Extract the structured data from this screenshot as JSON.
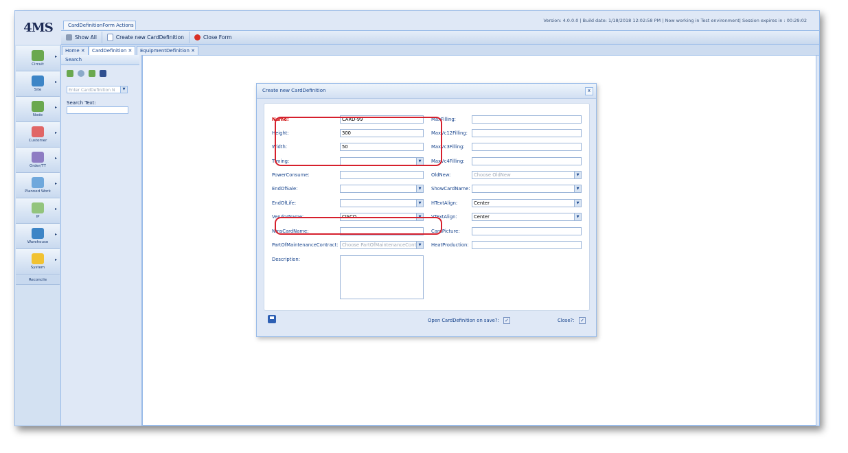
{
  "app": {
    "logo": "4MS",
    "version_info": "Version: 4.0.0.0 | Build date: 1/18/2018 12:02:58 PM | Now working in Test environment| Session expires in : 00:29:02"
  },
  "actions": {
    "title": "CardDefinitionForm Actions",
    "show_all": "Show All",
    "create_new": "Create new CardDefinition",
    "close_form": "Close Form"
  },
  "nav": {
    "items": [
      {
        "label": "Circuit",
        "icon": "circuit-icon",
        "color": "#6aa84f"
      },
      {
        "label": "Site",
        "icon": "site-icon",
        "color": "#3d85c6"
      },
      {
        "label": "Node",
        "icon": "node-icon",
        "color": "#6aa84f"
      },
      {
        "label": "Customer",
        "icon": "customer-icon",
        "color": "#e06666"
      },
      {
        "label": "Order/TT",
        "icon": "order-icon",
        "color": "#8e7cc3"
      },
      {
        "label": "Planned Work",
        "icon": "planned-work-icon",
        "color": "#6fa8dc"
      },
      {
        "label": "IP",
        "icon": "ip-icon",
        "color": "#93c47d"
      },
      {
        "label": "Warehouse",
        "icon": "warehouse-icon",
        "color": "#3d85c6"
      },
      {
        "label": "System",
        "icon": "system-icon",
        "color": "#f1c232"
      }
    ],
    "reconcile": "Reconcile"
  },
  "tabs": [
    {
      "label": "Home",
      "close": "✕"
    },
    {
      "label": "CardDefinition",
      "close": "✕"
    },
    {
      "label": "EquipmentDefinition",
      "close": "✕"
    }
  ],
  "search": {
    "title": "Search",
    "combo_placeholder": "Enter CardDefinition N",
    "search_text_label": "Search Text:"
  },
  "dialog": {
    "title": "Create new CardDefinition",
    "close": "x",
    "left_fields": {
      "name": {
        "label": "Name:",
        "value": "CARD-99"
      },
      "height": {
        "label": "Height:",
        "value": "300"
      },
      "width": {
        "label": "Width:",
        "value": "50"
      },
      "timing": {
        "label": "Timing:",
        "value": ""
      },
      "power_consume": {
        "label": "PowerConsume:",
        "value": ""
      },
      "end_of_sale": {
        "label": "EndOfSale:",
        "value": ""
      },
      "end_of_life": {
        "label": "EndOfLife:",
        "value": ""
      },
      "vendor_name": {
        "label": "VendorName:",
        "value": "CISCO"
      },
      "nms_card_name": {
        "label": "NmsCardName:",
        "value": ""
      },
      "part_of_maintenance": {
        "label": "PartOfMaintenanceContract:",
        "placeholder": "Choose PartOfMaintenanceContr"
      },
      "description": {
        "label": "Description:",
        "value": ""
      }
    },
    "right_fields": {
      "max_filling": {
        "label": "MaxFilling:",
        "value": ""
      },
      "max_vc12": {
        "label": "MaxVc12Filling:",
        "value": ""
      },
      "max_vc3": {
        "label": "MaxVc3Filling:",
        "value": ""
      },
      "max_vc4": {
        "label": "MaxVc4Filling:",
        "value": ""
      },
      "old_new": {
        "label": "OldNew:",
        "placeholder": "Choose OldNew"
      },
      "show_card_name": {
        "label": "ShowCardName:",
        "value": ""
      },
      "h_text_align": {
        "label": "HTextAlign:",
        "value": "Center"
      },
      "v_text_align": {
        "label": "VTextAlign:",
        "value": "Center"
      },
      "card_picture": {
        "label": "CardPicture:",
        "value": ""
      },
      "heat_production": {
        "label": "HeatProduction:",
        "value": ""
      }
    },
    "footer": {
      "open_on_save": "Open CardDefinition on save?:",
      "close_label": "Close?:",
      "check": "✓"
    }
  },
  "colors": {
    "highlight": "#d61f2c",
    "required_label": "#cc0000",
    "panel_bg": "#dfe8f6",
    "border": "#99bbe8"
  }
}
